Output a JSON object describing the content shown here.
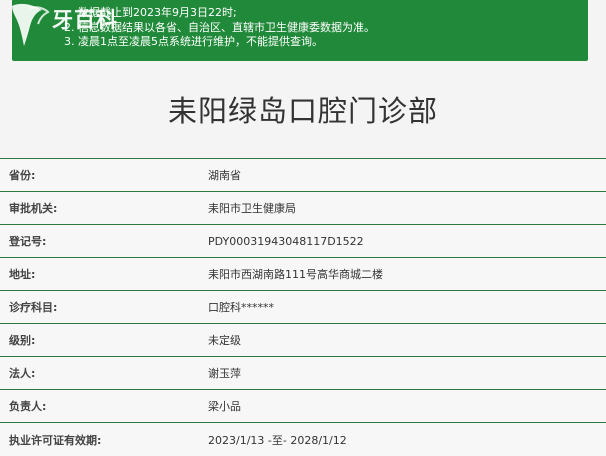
{
  "notice": {
    "lines": [
      {
        "num": "",
        "text": "数据截止到2023年9月3日22时;"
      },
      {
        "num": "2.",
        "text": "信息数据结果以各省、自治区、直辖市卫生健康委数据为准。"
      },
      {
        "num": "3.",
        "text": "凌晨1点至凌晨5点系统进行维护，不能提供查询。"
      }
    ],
    "bg_color": "#218a3a"
  },
  "logo": {
    "text": "牙百科"
  },
  "page": {
    "title": "耒阳绿岛口腔门诊部"
  },
  "rows": [
    {
      "label": "省份:",
      "value": "湖南省"
    },
    {
      "label": "审批机关:",
      "value": "耒阳市卫生健康局"
    },
    {
      "label": "登记号:",
      "value": "PDY00031943048117D1522"
    },
    {
      "label": "地址:",
      "value": "耒阳市西湖南路111号高华商城二楼"
    },
    {
      "label": "诊疗科目:",
      "value": "口腔科******"
    },
    {
      "label": "级别:",
      "value": "未定级"
    },
    {
      "label": "法人:",
      "value": "谢玉萍"
    },
    {
      "label": "负责人:",
      "value": "梁小品"
    },
    {
      "label": "执业许可证有效期:",
      "value": "2023/1/13 -至- 2028/1/12"
    }
  ]
}
